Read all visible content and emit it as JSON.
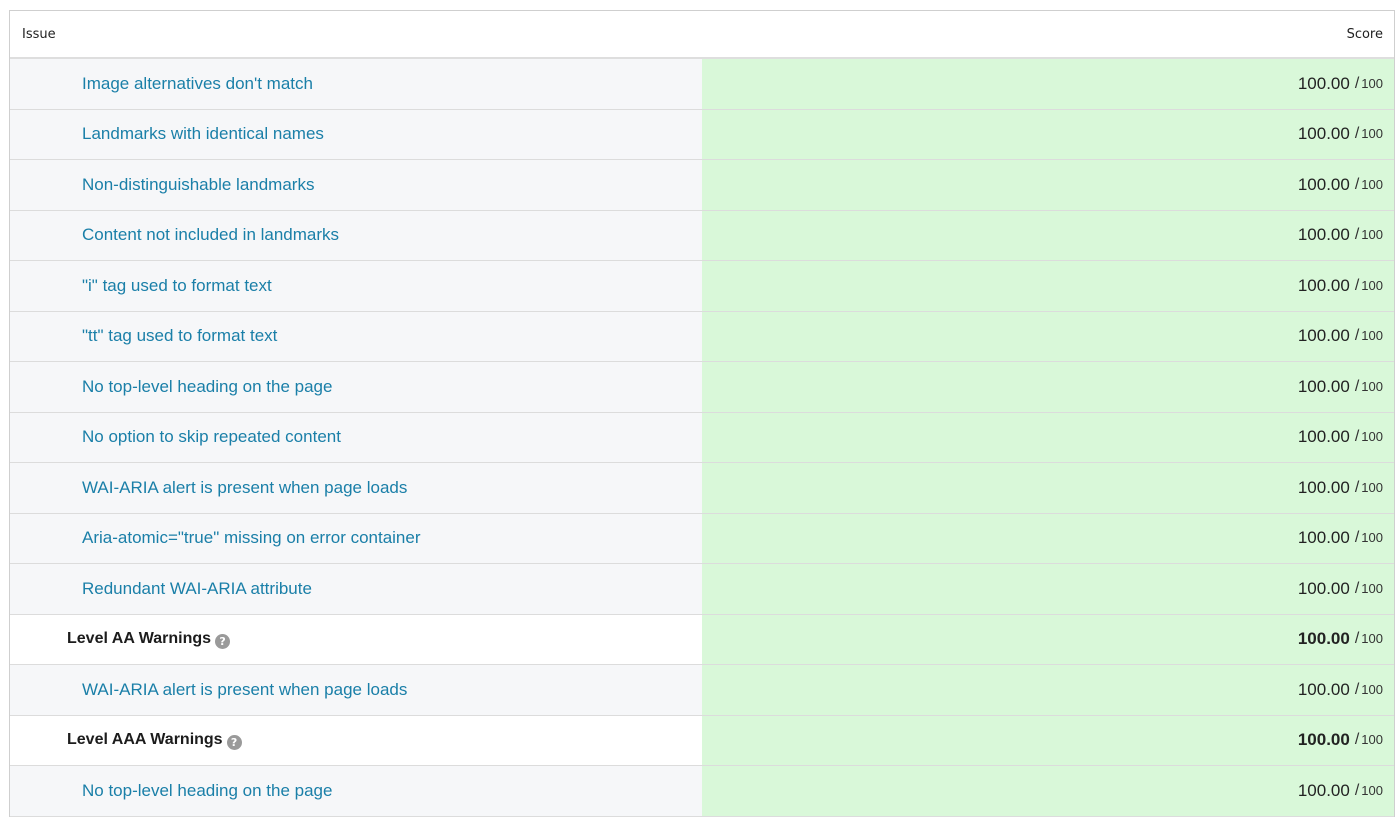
{
  "header": {
    "issue_label": "Issue",
    "score_label": "Score"
  },
  "rows": [
    {
      "type": "issue",
      "label": "Image alternatives don't match",
      "score": "100.00",
      "max": "100"
    },
    {
      "type": "issue",
      "label": "Landmarks with identical names",
      "score": "100.00",
      "max": "100"
    },
    {
      "type": "issue",
      "label": "Non-distinguishable landmarks",
      "score": "100.00",
      "max": "100"
    },
    {
      "type": "issue",
      "label": "Content not included in landmarks",
      "score": "100.00",
      "max": "100"
    },
    {
      "type": "issue",
      "label": "\"i\" tag used to format text",
      "score": "100.00",
      "max": "100"
    },
    {
      "type": "issue",
      "label": "\"tt\" tag used to format text",
      "score": "100.00",
      "max": "100"
    },
    {
      "type": "issue",
      "label": "No top-level heading on the page",
      "score": "100.00",
      "max": "100"
    },
    {
      "type": "issue",
      "label": "No option to skip repeated content",
      "score": "100.00",
      "max": "100"
    },
    {
      "type": "issue",
      "label": "WAI-ARIA alert is present when page loads",
      "score": "100.00",
      "max": "100"
    },
    {
      "type": "issue",
      "label": "Aria-atomic=\"true\" missing on error container",
      "score": "100.00",
      "max": "100"
    },
    {
      "type": "issue",
      "label": "Redundant WAI-ARIA attribute",
      "score": "100.00",
      "max": "100"
    },
    {
      "type": "group",
      "label": "Level AA Warnings",
      "score": "100.00",
      "max": "100",
      "icon": "help-icon",
      "icon_glyph": "?"
    },
    {
      "type": "issue",
      "label": "WAI-ARIA alert is present when page loads",
      "score": "100.00",
      "max": "100"
    },
    {
      "type": "group",
      "label": "Level AAA Warnings",
      "score": "100.00",
      "max": "100",
      "icon": "help-icon",
      "icon_glyph": "?"
    },
    {
      "type": "issue",
      "label": "No top-level heading on the page",
      "score": "100.00",
      "max": "100"
    }
  ],
  "colors": {
    "link": "#1a7fa8",
    "score_bg": "#d9f8d9",
    "row_bg": "#f6f7f9"
  }
}
